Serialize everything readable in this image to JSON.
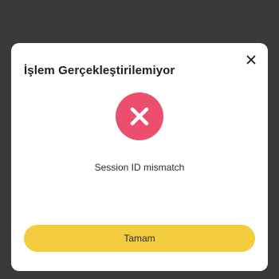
{
  "dialog": {
    "title": "İşlem Gerçekleştirilemiyor",
    "close_icon": "close-icon",
    "status_icon": "error-x-circle-icon",
    "message": "Session ID mismatch",
    "primary_button_label": "Tamam"
  },
  "colors": {
    "backdrop": "#3a3a3a",
    "modal_background": "#ffffff",
    "error_icon_bg": "#ec4e6d",
    "primary_button_bg": "#f3cd3d",
    "text": "#1e1e1e"
  }
}
